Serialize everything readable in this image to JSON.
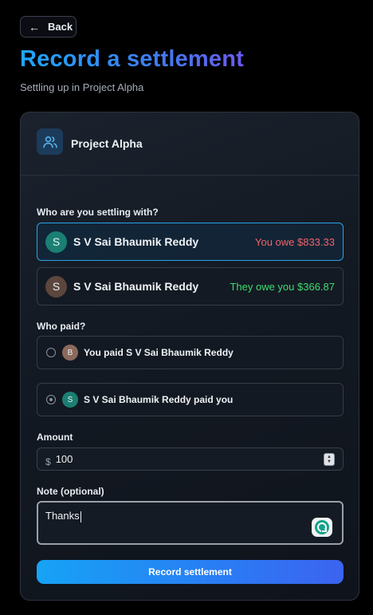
{
  "back_button": {
    "label": "Back",
    "icon": "arrow-left-icon"
  },
  "page": {
    "title": "Record a settlement",
    "subtitle": "Settling up in Project Alpha"
  },
  "project": {
    "name": "Project Alpha",
    "icon": "users-icon"
  },
  "settle_with": {
    "label": "Who are you settling with?",
    "people": [
      {
        "initial": "S",
        "name": "S V Sai Bhaumik Reddy",
        "balance": "You owe $833.33",
        "status": "owe",
        "selected": true
      },
      {
        "initial": "S",
        "name": "S V Sai Bhaumik Reddy",
        "balance": "They owe you $366.87",
        "status": "owed",
        "selected": false
      }
    ]
  },
  "who_paid": {
    "label": "Who paid?",
    "options": [
      {
        "initial": "B",
        "label": "You paid S V Sai Bhaumik Reddy",
        "checked": false
      },
      {
        "initial": "S",
        "label": "S V Sai Bhaumik Reddy paid you",
        "checked": true
      }
    ]
  },
  "amount": {
    "label": "Amount",
    "currency": "$",
    "value": "100"
  },
  "note": {
    "label": "Note (optional)",
    "value": "Thanks"
  },
  "submit": {
    "label": "Record settlement"
  },
  "colors": {
    "accent": "#1ea7ff",
    "owe": "#f0636b",
    "owed": "#3fdc72"
  }
}
